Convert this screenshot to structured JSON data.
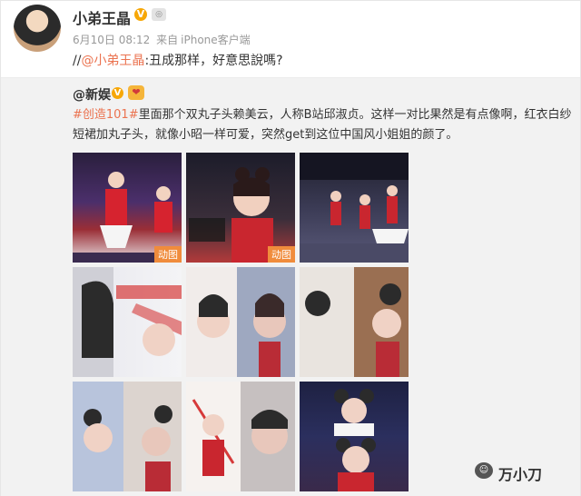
{
  "post": {
    "username": "小弟王晶",
    "date": "6月10日 08:12",
    "source_prefix": "来自",
    "source": "iPhone客户端",
    "repost_prefix": "//",
    "repost_mention": "@小弟王晶",
    "repost_body": ":丑成那样，好意思說嗎?"
  },
  "original": {
    "username": "@新娱",
    "hashtag": "#创造101#",
    "body": "里面那个双丸子头赖美云，人称B站邱淑贞。这样一对比果然是有点像啊，红衣白纱短裙加丸子头，就像小昭一样可爱，突然get到这位中国风小姐姐的颜了。",
    "images": [
      {
        "gif_label": "动图"
      },
      {
        "gif_label": "动图"
      },
      {
        "gif_label": ""
      },
      {
        "gif_label": ""
      },
      {
        "gif_label": ""
      },
      {
        "gif_label": ""
      },
      {
        "gif_label": ""
      },
      {
        "gif_label": ""
      },
      {
        "gif_label": ""
      }
    ]
  },
  "icons": {
    "verified": "V",
    "level": "◎",
    "heart": "❤",
    "watermark_icon": "☺"
  },
  "watermark": "万小刀"
}
